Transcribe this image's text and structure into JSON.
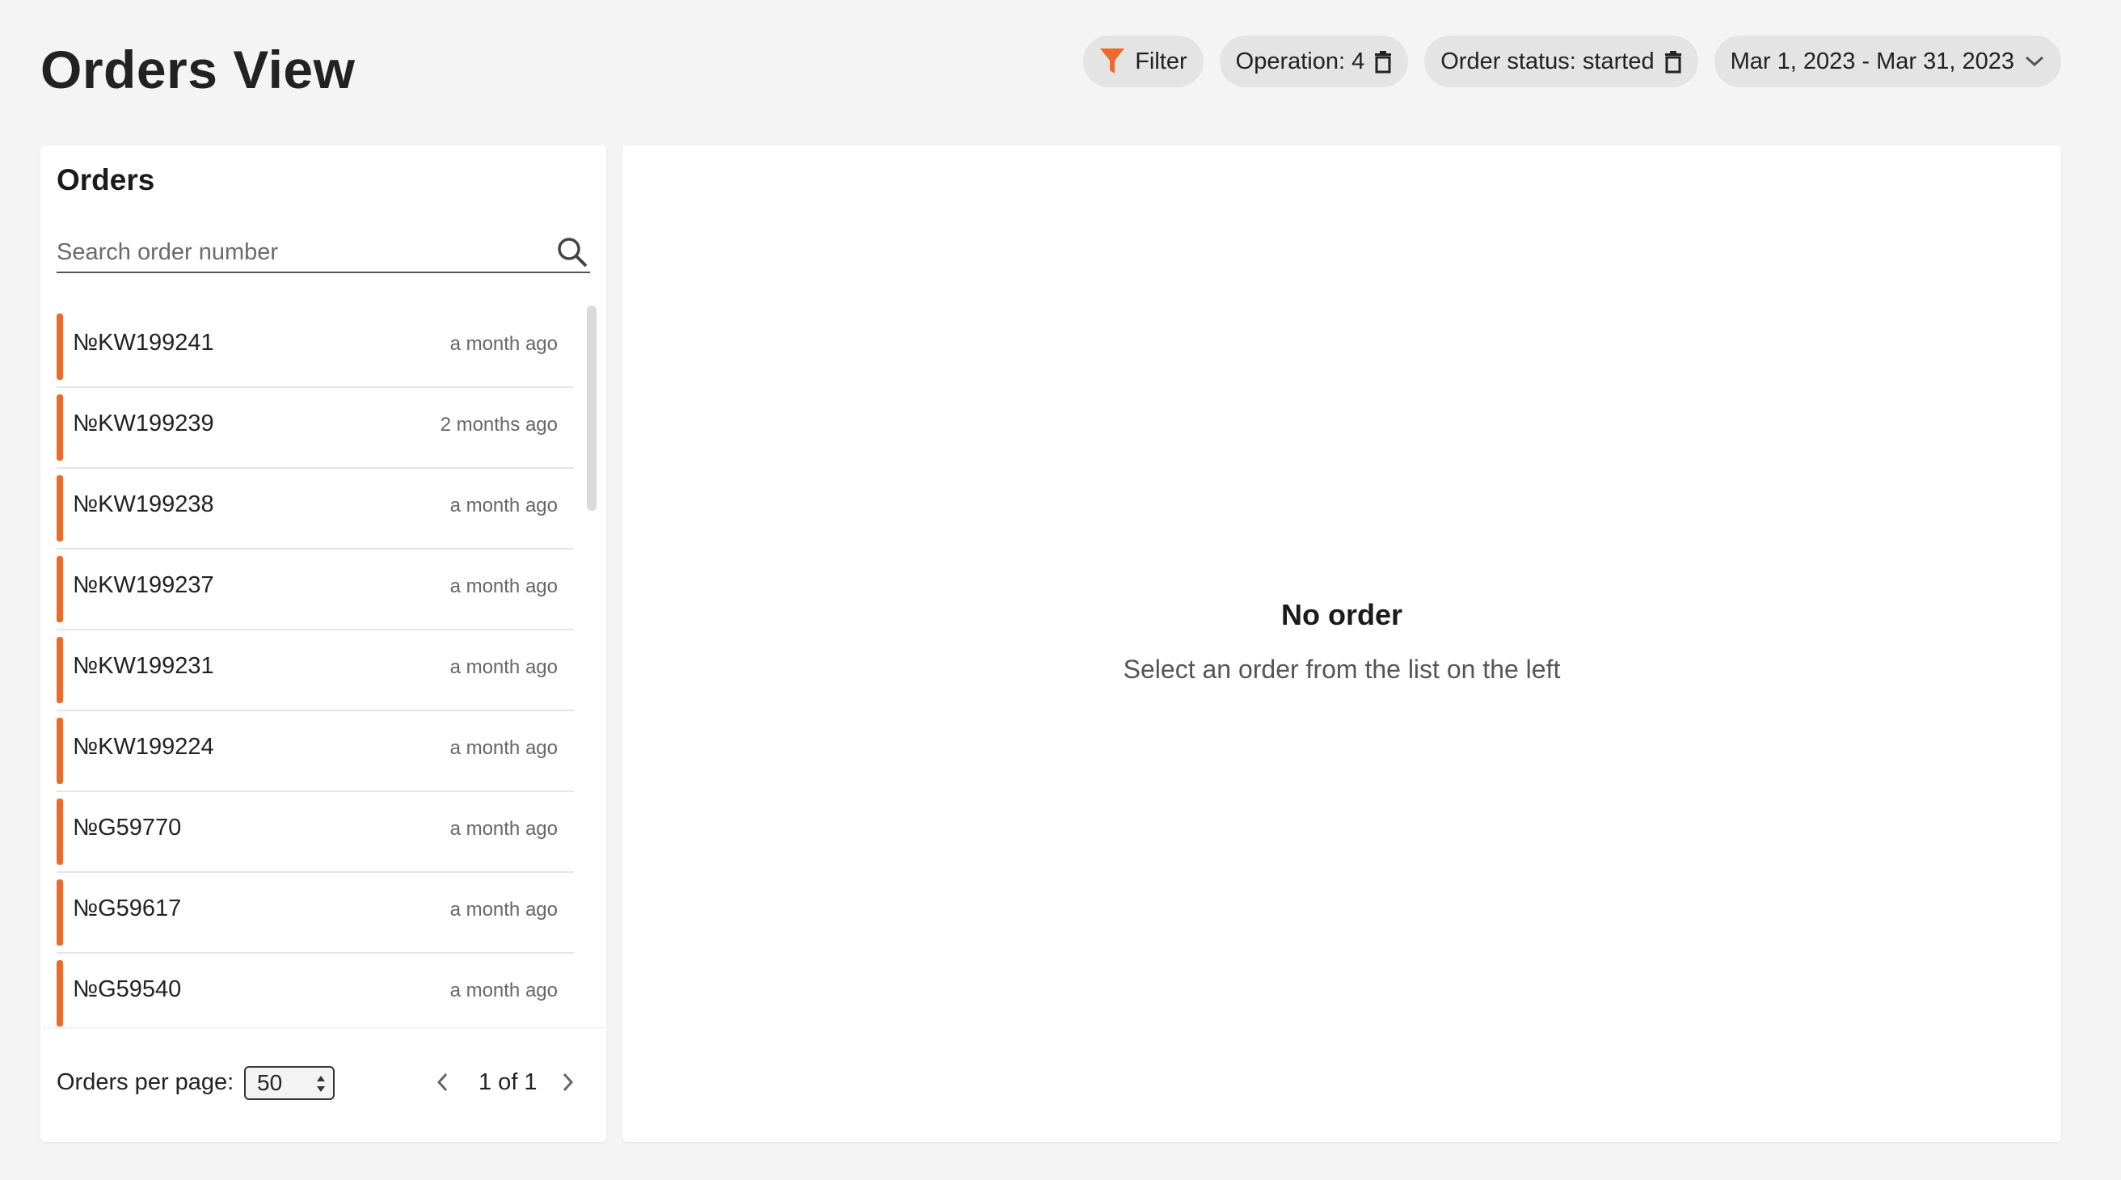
{
  "page": {
    "title": "Orders View"
  },
  "filters": {
    "filter_label": "Filter",
    "operation_label": "Operation: 4",
    "status_label": "Order status: started",
    "date_range_label": "Mar 1, 2023 - Mar 31, 2023"
  },
  "orders_panel": {
    "title": "Orders",
    "search_placeholder": "Search order number",
    "search_value": "",
    "orders": [
      {
        "number": "№KW199241",
        "time": "a month ago"
      },
      {
        "number": "№KW199239",
        "time": "2 months ago"
      },
      {
        "number": "№KW199238",
        "time": "a month ago"
      },
      {
        "number": "№KW199237",
        "time": "a month ago"
      },
      {
        "number": "№KW199231",
        "time": "a month ago"
      },
      {
        "number": "№KW199224",
        "time": "a month ago"
      },
      {
        "number": "№G59770",
        "time": "a month ago"
      },
      {
        "number": "№G59617",
        "time": "a month ago"
      },
      {
        "number": "№G59540",
        "time": "a month ago"
      }
    ],
    "footer": {
      "per_page_label": "Orders per page:",
      "per_page_value": "50",
      "pagination": "1 of 1"
    }
  },
  "detail_panel": {
    "empty_title": "No order",
    "empty_subtitle": "Select an order from the list on the left"
  },
  "colors": {
    "accent": "#ee6a2c",
    "background": "#f4f4f4",
    "chip_background": "#e4e4e4"
  },
  "icons": [
    "filter-icon",
    "trash-icon",
    "chevron-down-icon",
    "search-icon",
    "chevron-left-icon",
    "chevron-right-icon"
  ]
}
